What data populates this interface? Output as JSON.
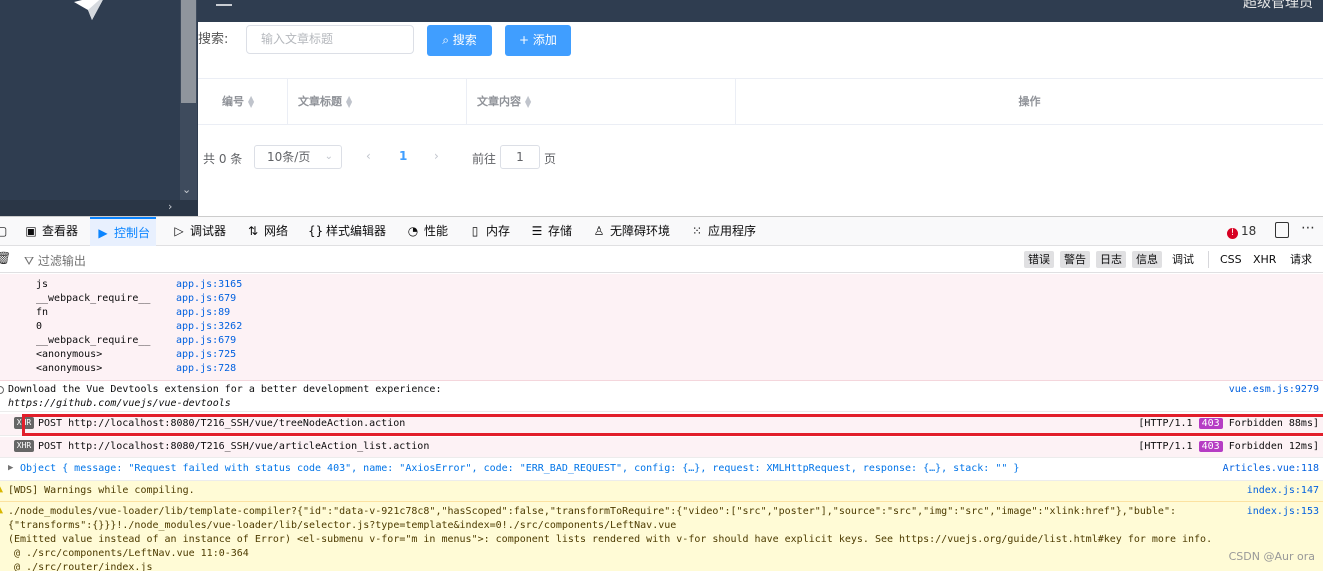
{
  "sidebar": {
    "logo_icon": "paper-plane-icon"
  },
  "topbar": {
    "user_text": "超级管理员"
  },
  "search": {
    "label": "搜索:",
    "placeholder": "输入文章标题",
    "search_button": "搜索",
    "add_button": "添加"
  },
  "table": {
    "columns": [
      "编号",
      "文章标题",
      "文章内容",
      "操作"
    ]
  },
  "pagination": {
    "total": "共 0 条",
    "page_size": "10条/页",
    "current_page": "1",
    "goto_label": "前往",
    "goto_value": "1",
    "page_suffix": "页"
  },
  "devtools": {
    "tabs": [
      "查看器",
      "控制台",
      "调试器",
      "网络",
      "样式编辑器",
      "性能",
      "内存",
      "存储",
      "无障碍环境",
      "应用程序"
    ],
    "active_tab": "控制台",
    "error_count": "18",
    "filter_placeholder": "过滤输出",
    "filter_buttons": [
      "错误",
      "警告",
      "日志",
      "信息",
      "调试",
      "CSS",
      "XHR",
      "请求"
    ]
  },
  "console": {
    "stack": [
      {
        "fn": "js",
        "file": "app.js:3165"
      },
      {
        "fn": "__webpack_require__",
        "file": "app.js:679"
      },
      {
        "fn": "fn",
        "file": "app.js:89"
      },
      {
        "fn": "0",
        "file": "app.js:3262"
      },
      {
        "fn": "__webpack_require__",
        "file": "app.js:679"
      },
      {
        "fn": "<anonymous>",
        "file": "app.js:725"
      },
      {
        "fn": "<anonymous>",
        "file": "app.js:728"
      }
    ],
    "devtools_msg": {
      "line1": "Download the Vue Devtools extension for a better development experience:",
      "line2": "https://github.com/vuejs/vue-devtools",
      "file": "vue.esm.js:9279"
    },
    "xhr1": {
      "badge": "XHR",
      "text": "POST http://localhost:8080/T216_SSH/vue/treeNodeAction.action",
      "proto": "[HTTP/1.1",
      "code": "403",
      "status": "Forbidden 88ms]"
    },
    "xhr2": {
      "badge": "XHR",
      "text": "POST http://localhost:8080/T216_SSH/vue/articleAction_list.action",
      "proto": "[HTTP/1.1",
      "code": "403",
      "status": "Forbidden 12ms]"
    },
    "object_msg": {
      "text": "Object { message: \"Request failed with status code 403\", name: \"AxiosError\", code: \"ERR_BAD_REQUEST\", config: {…}, request: XMLHttpRequest, response: {…}, stack: \"\" }",
      "file": "Articles.vue:118"
    },
    "wds_msg": {
      "text": "[WDS] Warnings while compiling.",
      "file": "index.js:147"
    },
    "compile_msg": {
      "line1": "./node_modules/vue-loader/lib/template-compiler?{\"id\":\"data-v-921c78c8\",\"hasScoped\":false,\"transformToRequire\":{\"video\":[\"src\",\"poster\"],\"source\":\"src\",\"img\":\"src\",\"image\":\"xlink:href\"},\"buble\":",
      "line2": "{\"transforms\":{}}}!./node_modules/vue-loader/lib/selector.js?type=template&index=0!./src/components/LeftNav.vue",
      "line3": "(Emitted value instead of an instance of Error) <el-submenu v-for=\"m in menus\">: component lists rendered with v-for should have explicit keys. See https://vuejs.org/guide/list.html#key for more info.",
      "line4": " @ ./src/components/LeftNav.vue 11:0-364",
      "line5": " @ ./src/router/index.js",
      "file": "index.js:153"
    }
  },
  "watermark": "CSDN @Aur ora"
}
